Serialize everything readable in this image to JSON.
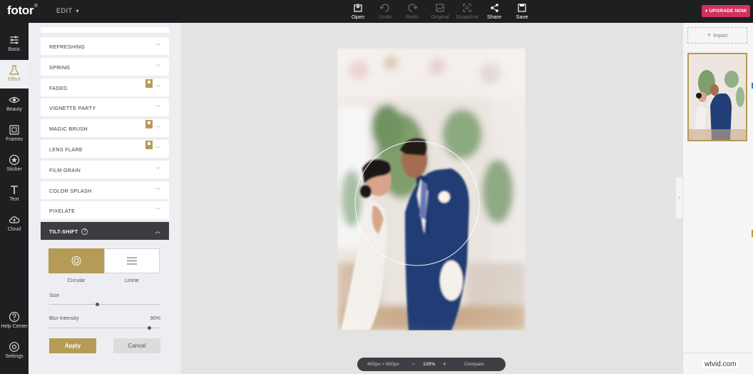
{
  "app": {
    "logo": "fotor",
    "logo_mark": "®",
    "edit_menu": "EDIT"
  },
  "toolbar": [
    {
      "label": "Open",
      "icon": "open-icon",
      "enabled": true
    },
    {
      "label": "Undo",
      "icon": "undo-icon",
      "enabled": false
    },
    {
      "label": "Redo",
      "icon": "redo-icon",
      "enabled": false
    },
    {
      "label": "Original",
      "icon": "original-icon",
      "enabled": false
    },
    {
      "label": "Snapshot",
      "icon": "snapshot-icon",
      "enabled": false
    },
    {
      "label": "Share",
      "icon": "share-icon",
      "enabled": true
    },
    {
      "label": "Save",
      "icon": "save-icon",
      "enabled": true
    }
  ],
  "upgrade_label": "UPGRADE NOW",
  "nav": [
    {
      "label": "Basic",
      "icon": "sliders-icon"
    },
    {
      "label": "Effect",
      "icon": "flask-icon",
      "active": true
    },
    {
      "label": "Beauty",
      "icon": "eye-icon"
    },
    {
      "label": "Frames",
      "icon": "frame-icon"
    },
    {
      "label": "Sticker",
      "icon": "star-icon"
    },
    {
      "label": "Text",
      "icon": "text-icon"
    },
    {
      "label": "Cloud",
      "icon": "cloud-upload-icon"
    },
    {
      "label": "Help Center",
      "icon": "help-icon"
    },
    {
      "label": "Settings",
      "icon": "gear-icon"
    }
  ],
  "effects": [
    {
      "label": "REFRESHING",
      "premium": false
    },
    {
      "label": "SPRING",
      "premium": false
    },
    {
      "label": "FADED",
      "premium": true
    },
    {
      "label": "VIGNETTE PARTY",
      "premium": false
    },
    {
      "label": "MAGIC BRUSH",
      "premium": true
    },
    {
      "label": "LENS FLARE",
      "premium": true
    },
    {
      "label": "FILM GRAIN",
      "premium": false
    },
    {
      "label": "COLOR SPLASH",
      "premium": false
    },
    {
      "label": "PIXELATE",
      "premium": false
    },
    {
      "label": "TILT-SHIFT",
      "premium": false,
      "expanded": true
    }
  ],
  "tiltshift": {
    "mode_circular": "Circular",
    "mode_linear": "Linear",
    "selected_mode": "Circular",
    "size_label": "Size",
    "size_value": 0.43,
    "blur_label": "Blur Intensity",
    "blur_value_text": "90%",
    "blur_value": 0.9,
    "apply": "Apply",
    "cancel": "Cancel"
  },
  "canvas": {
    "dimensions": "400px × 600px",
    "zoom_minus": "−",
    "zoom": "109%",
    "zoom_plus": "+",
    "compare": "Compare"
  },
  "right": {
    "import": "Import"
  },
  "watermark": "wtvid.com",
  "colors": {
    "accent": "#b59b55",
    "dark": "#1e1f21",
    "upgrade": "#d0325c"
  }
}
